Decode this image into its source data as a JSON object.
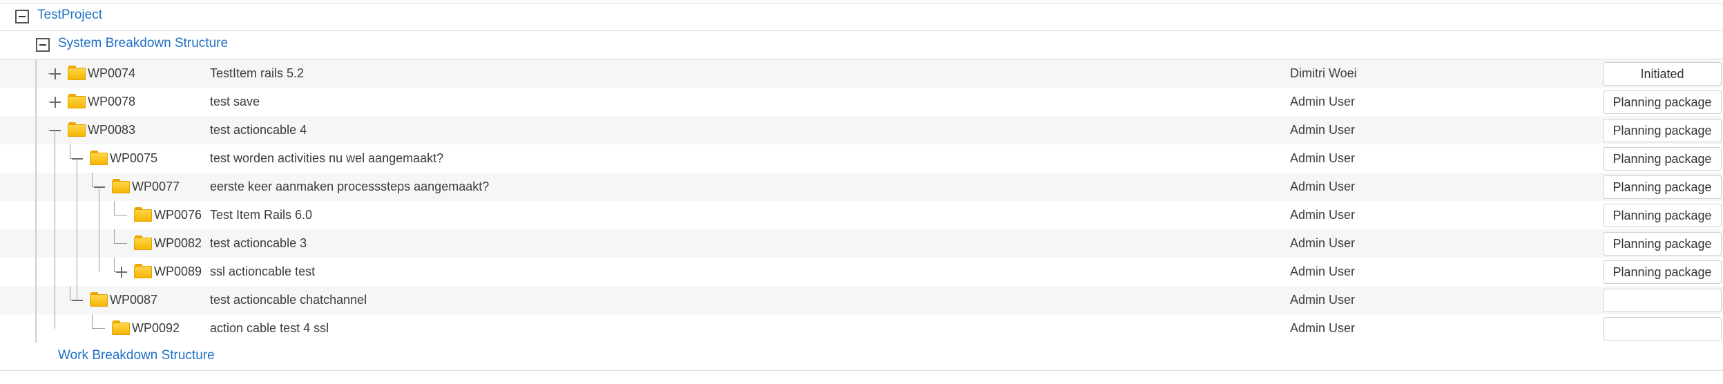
{
  "tree": {
    "root": {
      "label": "TestProject"
    },
    "sbs": {
      "label": "System Breakdown Structure"
    },
    "wbs": {
      "label": "Work Breakdown Structure"
    },
    "rows": [
      {
        "id": "WP0074",
        "name": "TestItem rails 5.2",
        "owner": "Dimitri Woei",
        "status": "Initiated",
        "level": 0,
        "toggle": "plus"
      },
      {
        "id": "WP0078",
        "name": "test save",
        "owner": "Admin User",
        "status": "Planning package",
        "level": 0,
        "toggle": "plus"
      },
      {
        "id": "WP0083",
        "name": "test actioncable 4",
        "owner": "Admin User",
        "status": "Planning package",
        "level": 0,
        "toggle": "minus"
      },
      {
        "id": "WP0075",
        "name": "test worden activities nu wel aangemaakt?",
        "owner": "Admin User",
        "status": "Planning package",
        "level": 1,
        "toggle": "minus"
      },
      {
        "id": "WP0077",
        "name": "eerste keer aanmaken processsteps aangemaakt?",
        "owner": "Admin User",
        "status": "Planning package",
        "level": 2,
        "toggle": "minus"
      },
      {
        "id": "WP0076",
        "name": "Test Item Rails 6.0",
        "owner": "Admin User",
        "status": "Planning package",
        "level": 3,
        "toggle": "none"
      },
      {
        "id": "WP0082",
        "name": "test actioncable 3",
        "owner": "Admin User",
        "status": "Planning package",
        "level": 3,
        "toggle": "none"
      },
      {
        "id": "WP0089",
        "name": "ssl actioncable test",
        "owner": "Admin User",
        "status": "Planning package",
        "level": 3,
        "toggle": "plus"
      },
      {
        "id": "WP0087",
        "name": "test actioncable chatchannel",
        "owner": "Admin User",
        "status": "",
        "level": 1,
        "toggle": "minus"
      },
      {
        "id": "WP0092",
        "name": "action cable test 4 ssl",
        "owner": "Admin User",
        "status": "",
        "level": 2,
        "toggle": "none"
      }
    ]
  },
  "icons": {
    "folder": "folder-icon",
    "collapse": "collapse-toggle-icon",
    "expand": "expand-toggle-icon"
  },
  "colors": {
    "link": "#1f6fc5",
    "folder": "#ffc928",
    "row_alt": "#f6f6f6"
  }
}
